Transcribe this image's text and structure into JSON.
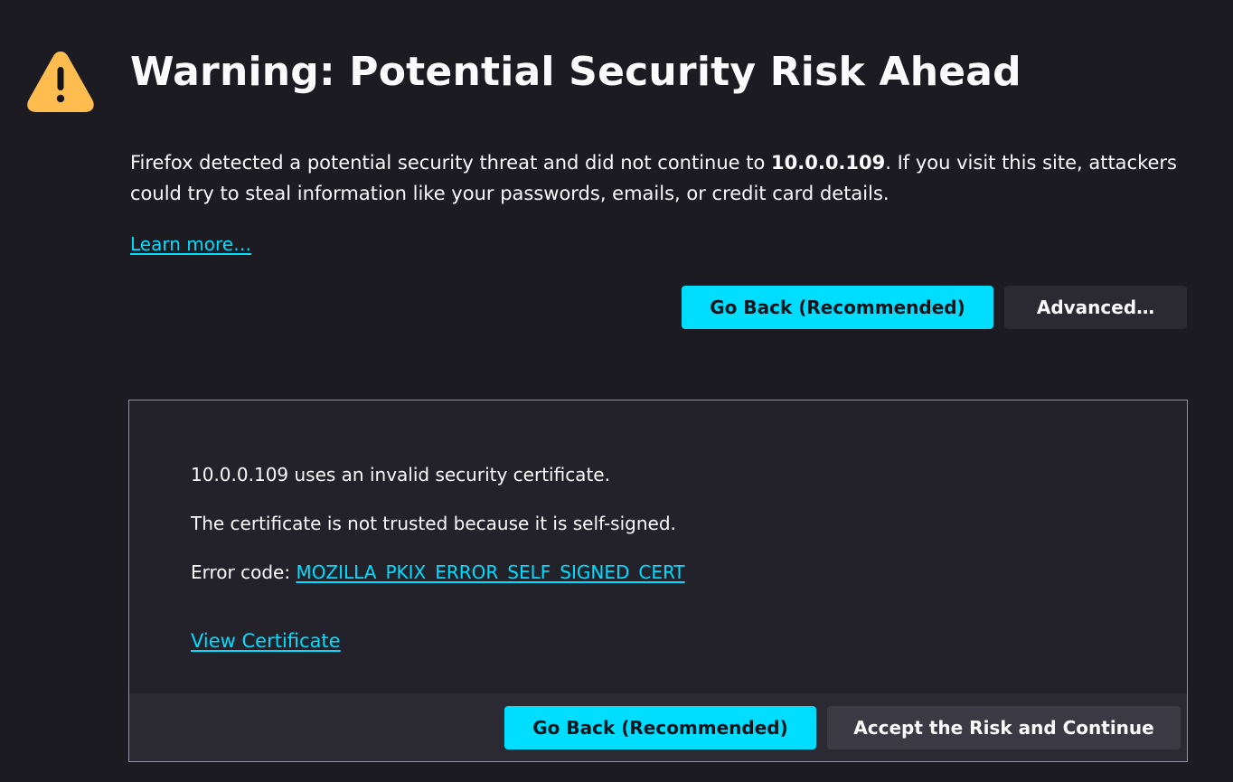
{
  "header": {
    "icon": "warning-triangle-icon",
    "icon_color": "#ffbd4f",
    "title": "Warning: Potential Security Risk Ahead"
  },
  "description": {
    "part1": "Firefox detected a potential security threat and did not continue to ",
    "host": "10.0.0.109",
    "part2": ". If you visit this site, attackers could try to steal information like your passwords, emails, or credit card details."
  },
  "learn_more": "Learn more…",
  "actions": {
    "go_back": "Go Back (Recommended)",
    "advanced": "Advanced…"
  },
  "advanced_panel": {
    "line1": "10.0.0.109 uses an invalid security certificate.",
    "line2": "The certificate is not trusted because it is self-signed.",
    "error_code_label": "Error code: ",
    "error_code": "MOZILLA_PKIX_ERROR_SELF_SIGNED_CERT",
    "view_certificate": "View Certificate",
    "go_back": "Go Back (Recommended)",
    "accept": "Accept the Risk and Continue"
  },
  "colors": {
    "background": "#1c1b22",
    "accent": "#00ddff",
    "panel": "#23222b",
    "panel_footer": "#2b2a33"
  }
}
